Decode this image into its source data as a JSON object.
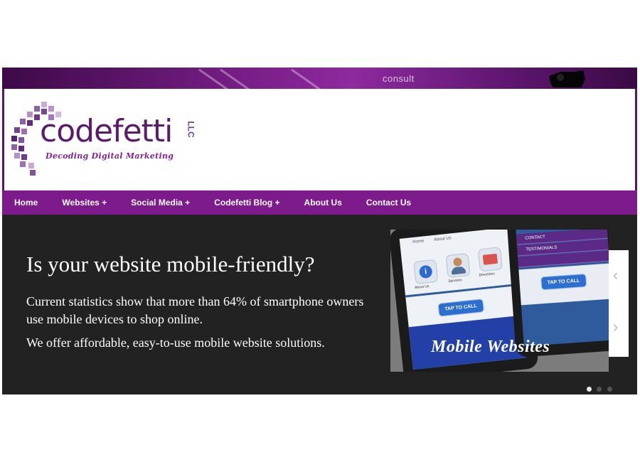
{
  "topbar": {
    "consult_label": "consult",
    "icon": "camera-icon"
  },
  "header": {
    "brand": "codefetti",
    "suffix": "LLC",
    "tagline": "Decoding Digital Marketing"
  },
  "nav": {
    "items": [
      "Home",
      "Websites +",
      "Social Media +",
      "Codefetti Blog +",
      "About Us",
      "Contact Us"
    ]
  },
  "hero": {
    "title": "Is your website mobile-friendly?",
    "paragraph1": "Current statistics show that more than 64% of smartphone owners use mobile devices to shop online.",
    "paragraph2": "We offer affordable, easy-to-use mobile website solutions."
  },
  "slide": {
    "caption": "Mobile Websites",
    "phone1_tabs": [
      "Home",
      "About Us"
    ],
    "phone1_apps": [
      "About Us",
      "Services",
      "Directions"
    ],
    "tap_to_call": "TAP TO CALL",
    "phone2_menu": [
      "CONTACT",
      "TESTIMONIALS"
    ]
  },
  "slider": {
    "prev_icon": "chevron-left-icon",
    "next_icon": "chevron-right-icon",
    "dot_count": 3,
    "active_dot": 0
  },
  "colors": {
    "brand_purple": "#7d1b8c",
    "hero_bg": "#222222"
  }
}
